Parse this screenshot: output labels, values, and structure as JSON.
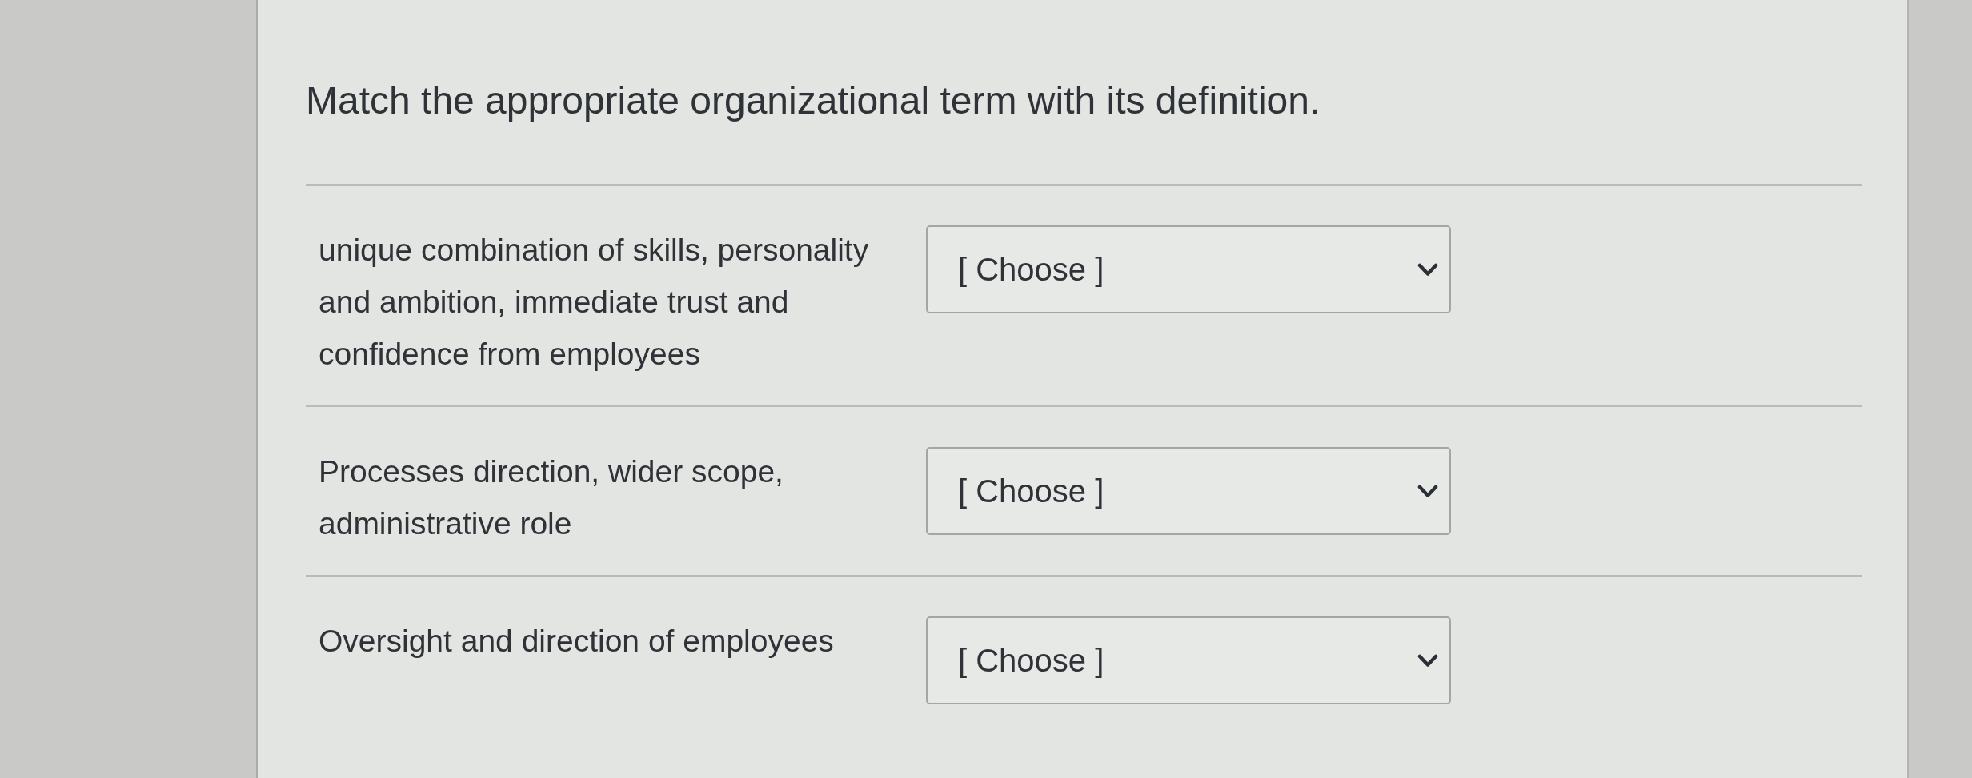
{
  "question": {
    "prompt": "Match the appropriate organizational term with its definition."
  },
  "items": [
    {
      "definition": "unique combination of skills, personality and ambition, immediate trust and confidence from employees",
      "dropdown": {
        "value": "[ Choose ]"
      }
    },
    {
      "definition": "Processes direction, wider scope, administrative role",
      "dropdown": {
        "value": "[ Choose ]"
      }
    },
    {
      "definition": "Oversight and direction of employees",
      "dropdown": {
        "value": "[ Choose ]"
      }
    }
  ]
}
